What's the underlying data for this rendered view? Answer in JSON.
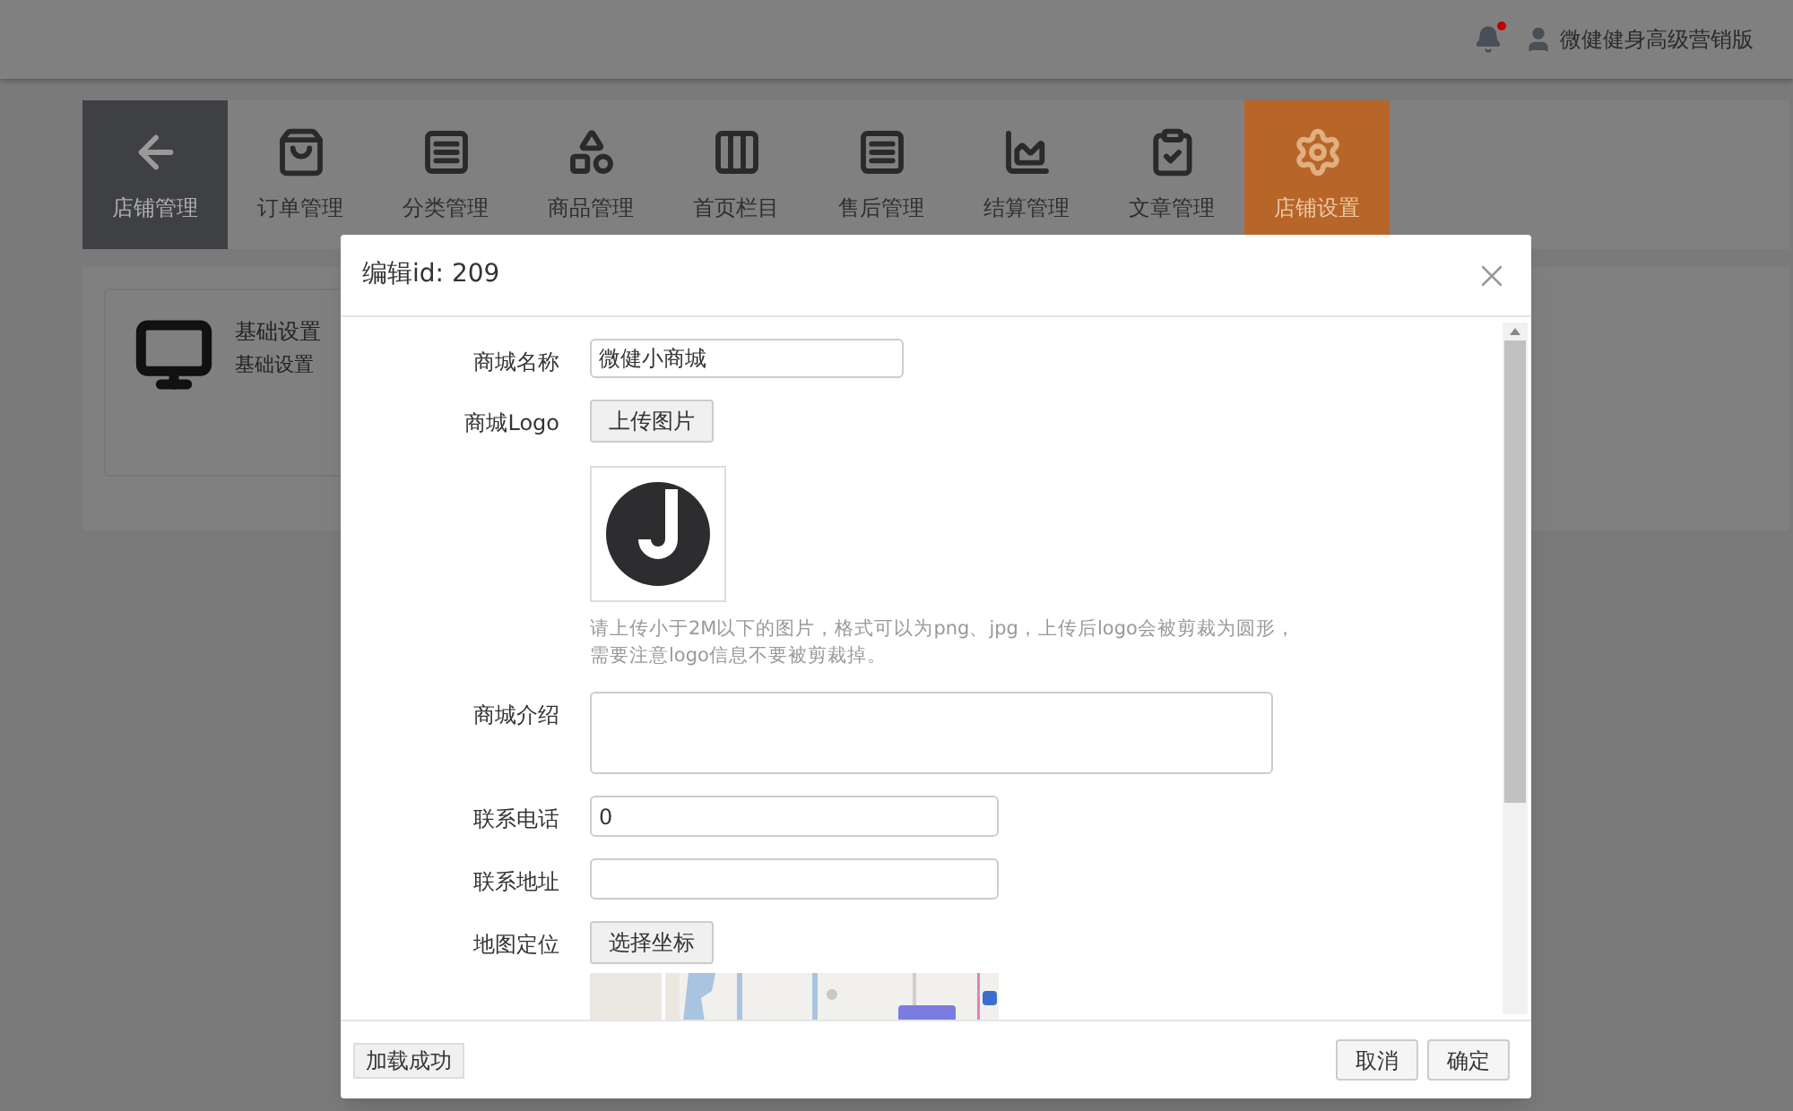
{
  "header": {
    "user": "微健健身高级营销版"
  },
  "nav": [
    {
      "label": "店铺管理",
      "kind": "back"
    },
    {
      "label": "订单管理",
      "kind": "item",
      "selected": false
    },
    {
      "label": "分类管理",
      "kind": "item",
      "selected": false
    },
    {
      "label": "商品管理",
      "kind": "item",
      "selected": false
    },
    {
      "label": "首页栏目",
      "kind": "item",
      "selected": false
    },
    {
      "label": "售后管理",
      "kind": "item",
      "selected": false
    },
    {
      "label": "结算管理",
      "kind": "item",
      "selected": false
    },
    {
      "label": "文章管理",
      "kind": "item",
      "selected": false
    },
    {
      "label": "店铺设置",
      "kind": "item",
      "selected": true
    }
  ],
  "settings_card": {
    "title": "基础设置",
    "subtitle": "基础设置"
  },
  "modal": {
    "title": "编辑id: 209",
    "fields": [
      {
        "label": "商城名称",
        "kind": "input",
        "value": "微健小商城"
      },
      {
        "label": "商城Logo",
        "kind": "upload",
        "button": "上传图片",
        "hint": [
          "请上传小于2M以下的图片，格式可以为png、jpg，上传后logo会被剪裁为圆形，",
          "需要注意logo信息不要被剪裁掉。"
        ]
      },
      {
        "label": "商城介绍",
        "kind": "textarea"
      },
      {
        "label": "联系电话",
        "kind": "input_short",
        "value": "0"
      },
      {
        "label": "联系地址",
        "kind": "input_short"
      },
      {
        "label": "地图定位",
        "kind": "map",
        "button": "选择坐标"
      }
    ],
    "status": "加载成功",
    "buttons": [
      "取消",
      "确定"
    ]
  }
}
